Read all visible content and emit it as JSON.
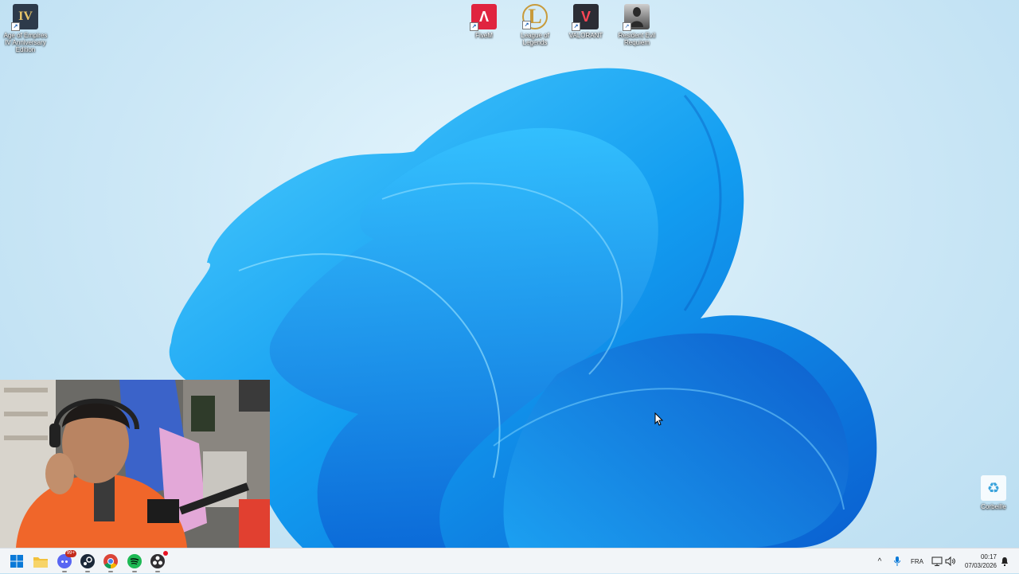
{
  "desktop": {
    "icons": [
      {
        "label": "Age of Empires IV Anniversary Edition",
        "glyph": "IV",
        "color": "#2d3a4a"
      },
      {
        "label": "FiveM",
        "glyph": "Λ",
        "color": "#e0243f"
      },
      {
        "label": "League of Legends",
        "glyph": "L",
        "color": "#c89b3c"
      },
      {
        "label": "VALORANT",
        "glyph": "V",
        "color": "#2b2d35"
      },
      {
        "label": "Resident Evil Requiem",
        "glyph": "",
        "color": "#5b5b5b"
      },
      {
        "label": "Corbeille",
        "glyph": "♻",
        "color": "#3aa3dc"
      }
    ]
  },
  "taskbar": {
    "apps": [
      {
        "name": "start-button",
        "icon": "windows-logo-icon",
        "color": "#0a7ad8"
      },
      {
        "name": "file-explorer",
        "icon": "folder-icon",
        "color": "#f2c13b"
      },
      {
        "name": "discord",
        "icon": "discord-icon",
        "color": "#5865f2",
        "badge": "99+"
      },
      {
        "name": "steam",
        "icon": "steam-icon",
        "color": "#1b2838"
      },
      {
        "name": "chrome",
        "icon": "chrome-icon",
        "color": "#db4437"
      },
      {
        "name": "spotify",
        "icon": "spotify-icon",
        "color": "#1db954"
      },
      {
        "name": "obs",
        "icon": "obs-icon",
        "color": "#302e31"
      }
    ],
    "tray": {
      "chevron": "^",
      "language": "FRA",
      "time": "00:17",
      "date": "07/03/2026"
    }
  }
}
